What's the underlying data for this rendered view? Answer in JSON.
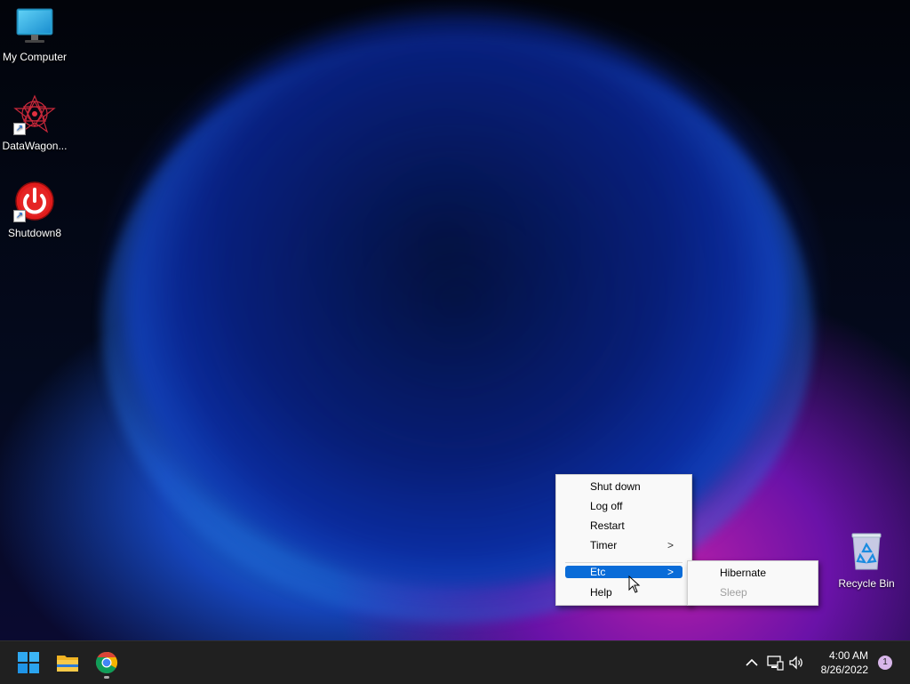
{
  "desktop": {
    "icons": [
      {
        "label": "My Computer",
        "icon": "monitor-icon"
      },
      {
        "label": "DataWagon...",
        "icon": "star-knot-icon"
      },
      {
        "label": "Shutdown8",
        "icon": "power-icon"
      },
      {
        "label": "Recycle Bin",
        "icon": "recycle-bin-icon"
      }
    ]
  },
  "context_menu": {
    "items": [
      {
        "label": "Shut down"
      },
      {
        "label": "Log off"
      },
      {
        "label": "Restart"
      },
      {
        "label": "Timer",
        "submenu_arrow": ">"
      },
      {
        "label": "Etc",
        "submenu_arrow": ">",
        "highlighted": true
      },
      {
        "label": "Help"
      }
    ]
  },
  "submenu": {
    "items": [
      {
        "label": "Hibernate",
        "enabled": true
      },
      {
        "label": "Sleep",
        "enabled": false
      }
    ]
  },
  "taskbar": {
    "pinned": [
      {
        "name": "start-button",
        "icon": "windows-logo-icon"
      },
      {
        "name": "file-explorer",
        "icon": "folder-icon"
      },
      {
        "name": "chrome",
        "icon": "chrome-icon",
        "running": true
      }
    ],
    "tray": {
      "icons": [
        "chevron-up-icon",
        "network-icon",
        "volume-icon"
      ],
      "time": "4:00 AM",
      "date": "8/26/2022",
      "notification_count": "1"
    }
  },
  "colors": {
    "menu_highlight": "#0a6cd8",
    "taskbar_bg": "#202020",
    "menu_bg": "#f9f9f9"
  }
}
